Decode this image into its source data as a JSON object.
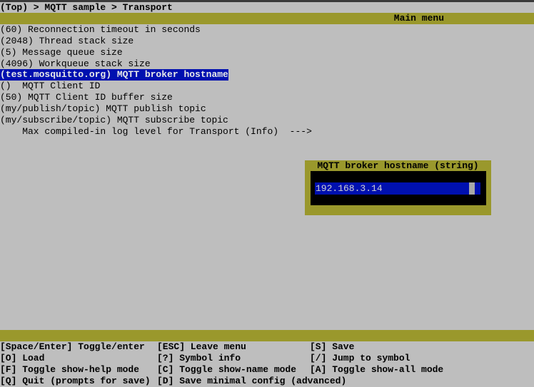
{
  "breadcrumb": "(Top) > MQTT sample > Transport",
  "menu_title": "Main menu",
  "items": [
    "(60) Reconnection timeout in seconds",
    "(2048) Thread stack size",
    "(5) Message queue size",
    "(4096) Workqueue stack size",
    "(test.mosquitto.org) MQTT broker hostname",
    "()  MQTT Client ID",
    "(50) MQTT Client ID buffer size",
    "(my/publish/topic) MQTT publish topic",
    "(my/subscribe/topic) MQTT subscribe topic",
    "    Max compiled-in log level for Transport (Info)  --->"
  ],
  "selected_index": 4,
  "dialog": {
    "title": "MQTT broker hostname (string)",
    "value": "192.168.3.14"
  },
  "footer": [
    [
      "[Space/Enter] Toggle/enter",
      "[ESC] Leave menu",
      "[S] Save"
    ],
    [
      "[O] Load",
      "[?] Symbol info",
      "[/] Jump to symbol"
    ],
    [
      "[F] Toggle show-help mode",
      "[C] Toggle show-name mode",
      "[A] Toggle show-all mode"
    ],
    [
      "[Q] Quit (prompts for save)",
      "[D] Save minimal config (advanced)",
      ""
    ]
  ],
  "colors": {
    "background": "#bebebe",
    "bar": "#9a982c",
    "selection": "#0010b0"
  }
}
